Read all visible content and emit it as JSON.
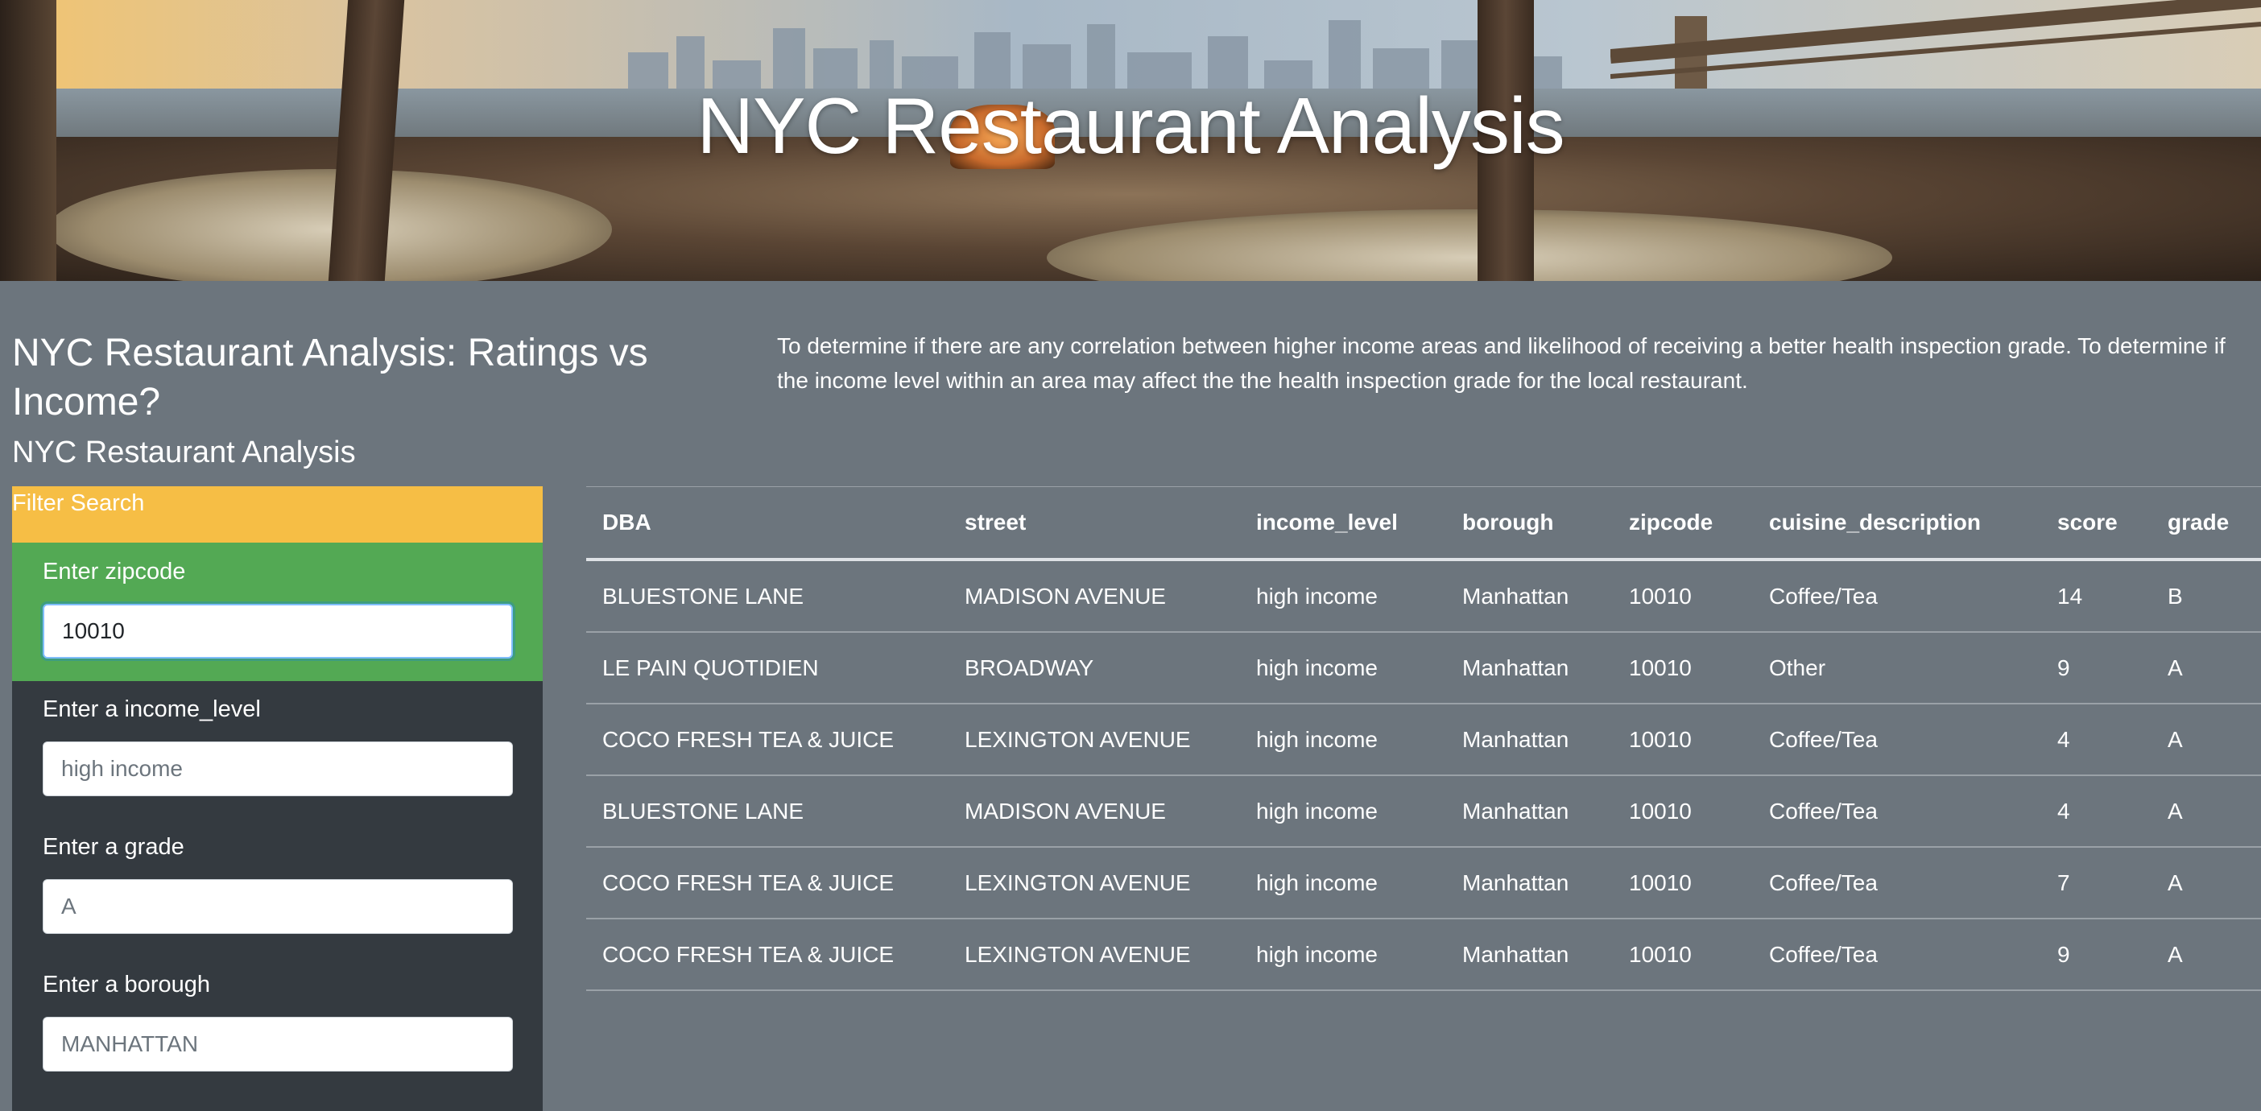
{
  "hero": {
    "title": "NYC Restaurant Analysis"
  },
  "intro": {
    "heading": "NYC Restaurant Analysis: Ratings vs Income?",
    "subheading": "NYC Restaurant Analysis",
    "description": "To determine if there are any correlation between higher income areas and likelihood of receiving a better health inspection grade. To determine if the income level within an area may affect the the health inspection grade for the local restaurant."
  },
  "filters": {
    "header": "Filter Search",
    "zipcode": {
      "label": "Enter zipcode",
      "value": "10010",
      "placeholder": ""
    },
    "income_level": {
      "label": "Enter a income_level",
      "value": "",
      "placeholder": "high income"
    },
    "grade": {
      "label": "Enter a grade",
      "value": "",
      "placeholder": "A"
    },
    "borough": {
      "label": "Enter a borough",
      "value": "",
      "placeholder": "MANHATTAN"
    }
  },
  "table": {
    "columns": [
      "DBA",
      "street",
      "income_level",
      "borough",
      "zipcode",
      "cuisine_description",
      "score",
      "grade"
    ],
    "rows": [
      [
        "BLUESTONE LANE",
        "MADISON AVENUE",
        "high income",
        "Manhattan",
        "10010",
        "Coffee/Tea",
        "14",
        "B"
      ],
      [
        "LE PAIN QUOTIDIEN",
        "BROADWAY",
        "high income",
        "Manhattan",
        "10010",
        "Other",
        "9",
        "A"
      ],
      [
        "COCO FRESH TEA & JUICE",
        "LEXINGTON AVENUE",
        "high income",
        "Manhattan",
        "10010",
        "Coffee/Tea",
        "4",
        "A"
      ],
      [
        "BLUESTONE LANE",
        "MADISON AVENUE",
        "high income",
        "Manhattan",
        "10010",
        "Coffee/Tea",
        "4",
        "A"
      ],
      [
        "COCO FRESH TEA & JUICE",
        "LEXINGTON AVENUE",
        "high income",
        "Manhattan",
        "10010",
        "Coffee/Tea",
        "7",
        "A"
      ],
      [
        "COCO FRESH TEA & JUICE",
        "LEXINGTON AVENUE",
        "high income",
        "Manhattan",
        "10010",
        "Coffee/Tea",
        "9",
        "A"
      ]
    ]
  },
  "colors": {
    "page_background": "#6c757d",
    "filter_header": "#f6be45",
    "active_filter": "#53a954",
    "filter_panel": "#343a40"
  }
}
